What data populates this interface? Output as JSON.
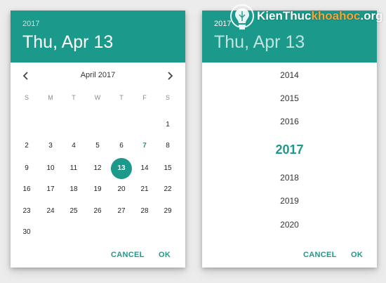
{
  "left_dialog": {
    "header_year": "2017",
    "header_date": "Thu, Apr 13",
    "month_label": "April 2017",
    "prev_icon": "chevron-left-icon",
    "next_icon": "chevron-right-icon",
    "weekdays": [
      "S",
      "M",
      "T",
      "W",
      "T",
      "F",
      "S"
    ],
    "weeks": [
      [
        "",
        "",
        "",
        "",
        "",
        "",
        "1"
      ],
      [
        "2",
        "3",
        "4",
        "5",
        "6",
        "7",
        "8"
      ],
      [
        "9",
        "10",
        "11",
        "12",
        "13",
        "14",
        "15"
      ],
      [
        "16",
        "17",
        "18",
        "19",
        "20",
        "21",
        "22"
      ],
      [
        "23",
        "24",
        "25",
        "26",
        "27",
        "28",
        "29"
      ],
      [
        "30",
        "",
        "",
        "",
        "",
        "",
        ""
      ]
    ],
    "today": "7",
    "selected": "13",
    "cancel_label": "CANCEL",
    "ok_label": "OK"
  },
  "right_dialog": {
    "header_year": "2017",
    "header_date": "Thu, Apr 13",
    "years": [
      "2014",
      "2015",
      "2016",
      "2017",
      "2018",
      "2019",
      "2020"
    ],
    "selected_year": "2017",
    "cancel_label": "CANCEL",
    "ok_label": "OK"
  },
  "watermark": {
    "text_main": "KienThuc",
    "text_accent": "khoahoc",
    "text_suffix": ".org",
    "icon": "lightbulb-icon"
  },
  "colors": {
    "accent": "#1b998b",
    "watermark_accent": "#f3a43a"
  }
}
